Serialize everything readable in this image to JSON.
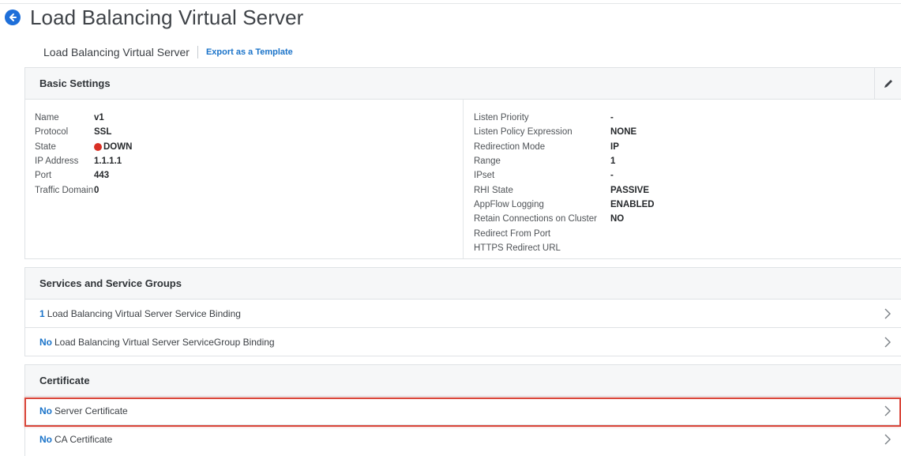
{
  "header": {
    "title": "Load Balancing Virtual Server",
    "breadcrumb": "Load Balancing Virtual Server",
    "export_link": "Export as a Template"
  },
  "basic_settings": {
    "title": "Basic Settings",
    "left": [
      {
        "label": "Name",
        "value": "v1"
      },
      {
        "label": "Protocol",
        "value": "SSL"
      },
      {
        "label": "State",
        "value": "DOWN",
        "status_color": "#d93025"
      },
      {
        "label": "IP Address",
        "value": "1.1.1.1"
      },
      {
        "label": "Port",
        "value": "443"
      },
      {
        "label": "Traffic Domain",
        "value": "0"
      }
    ],
    "right": [
      {
        "label": "Listen Priority",
        "value": "-"
      },
      {
        "label": "Listen Policy Expression",
        "value": "NONE"
      },
      {
        "label": "Redirection Mode",
        "value": "IP"
      },
      {
        "label": "Range",
        "value": "1"
      },
      {
        "label": "IPset",
        "value": "-"
      },
      {
        "label": "RHI State",
        "value": "PASSIVE"
      },
      {
        "label": "AppFlow Logging",
        "value": "ENABLED"
      },
      {
        "label": "Retain Connections on Cluster",
        "value": "NO"
      },
      {
        "label": "Redirect From Port",
        "value": ""
      },
      {
        "label": "HTTPS Redirect URL",
        "value": ""
      }
    ]
  },
  "services": {
    "title": "Services and Service Groups",
    "rows": [
      {
        "count": "1",
        "label": "Load Balancing Virtual Server Service Binding"
      },
      {
        "count": "No",
        "label": "Load Balancing Virtual Server ServiceGroup Binding"
      }
    ]
  },
  "certificate": {
    "title": "Certificate",
    "rows": [
      {
        "count": "No",
        "label": "Server Certificate"
      },
      {
        "count": "No",
        "label": "CA Certificate"
      }
    ]
  },
  "colors": {
    "accent": "#1a73c9",
    "highlight": "#d9463a",
    "status_down": "#d93025"
  },
  "icons": {
    "back": "arrow-left-circle-icon",
    "edit": "pencil-icon",
    "row": "chevron-right-icon"
  }
}
